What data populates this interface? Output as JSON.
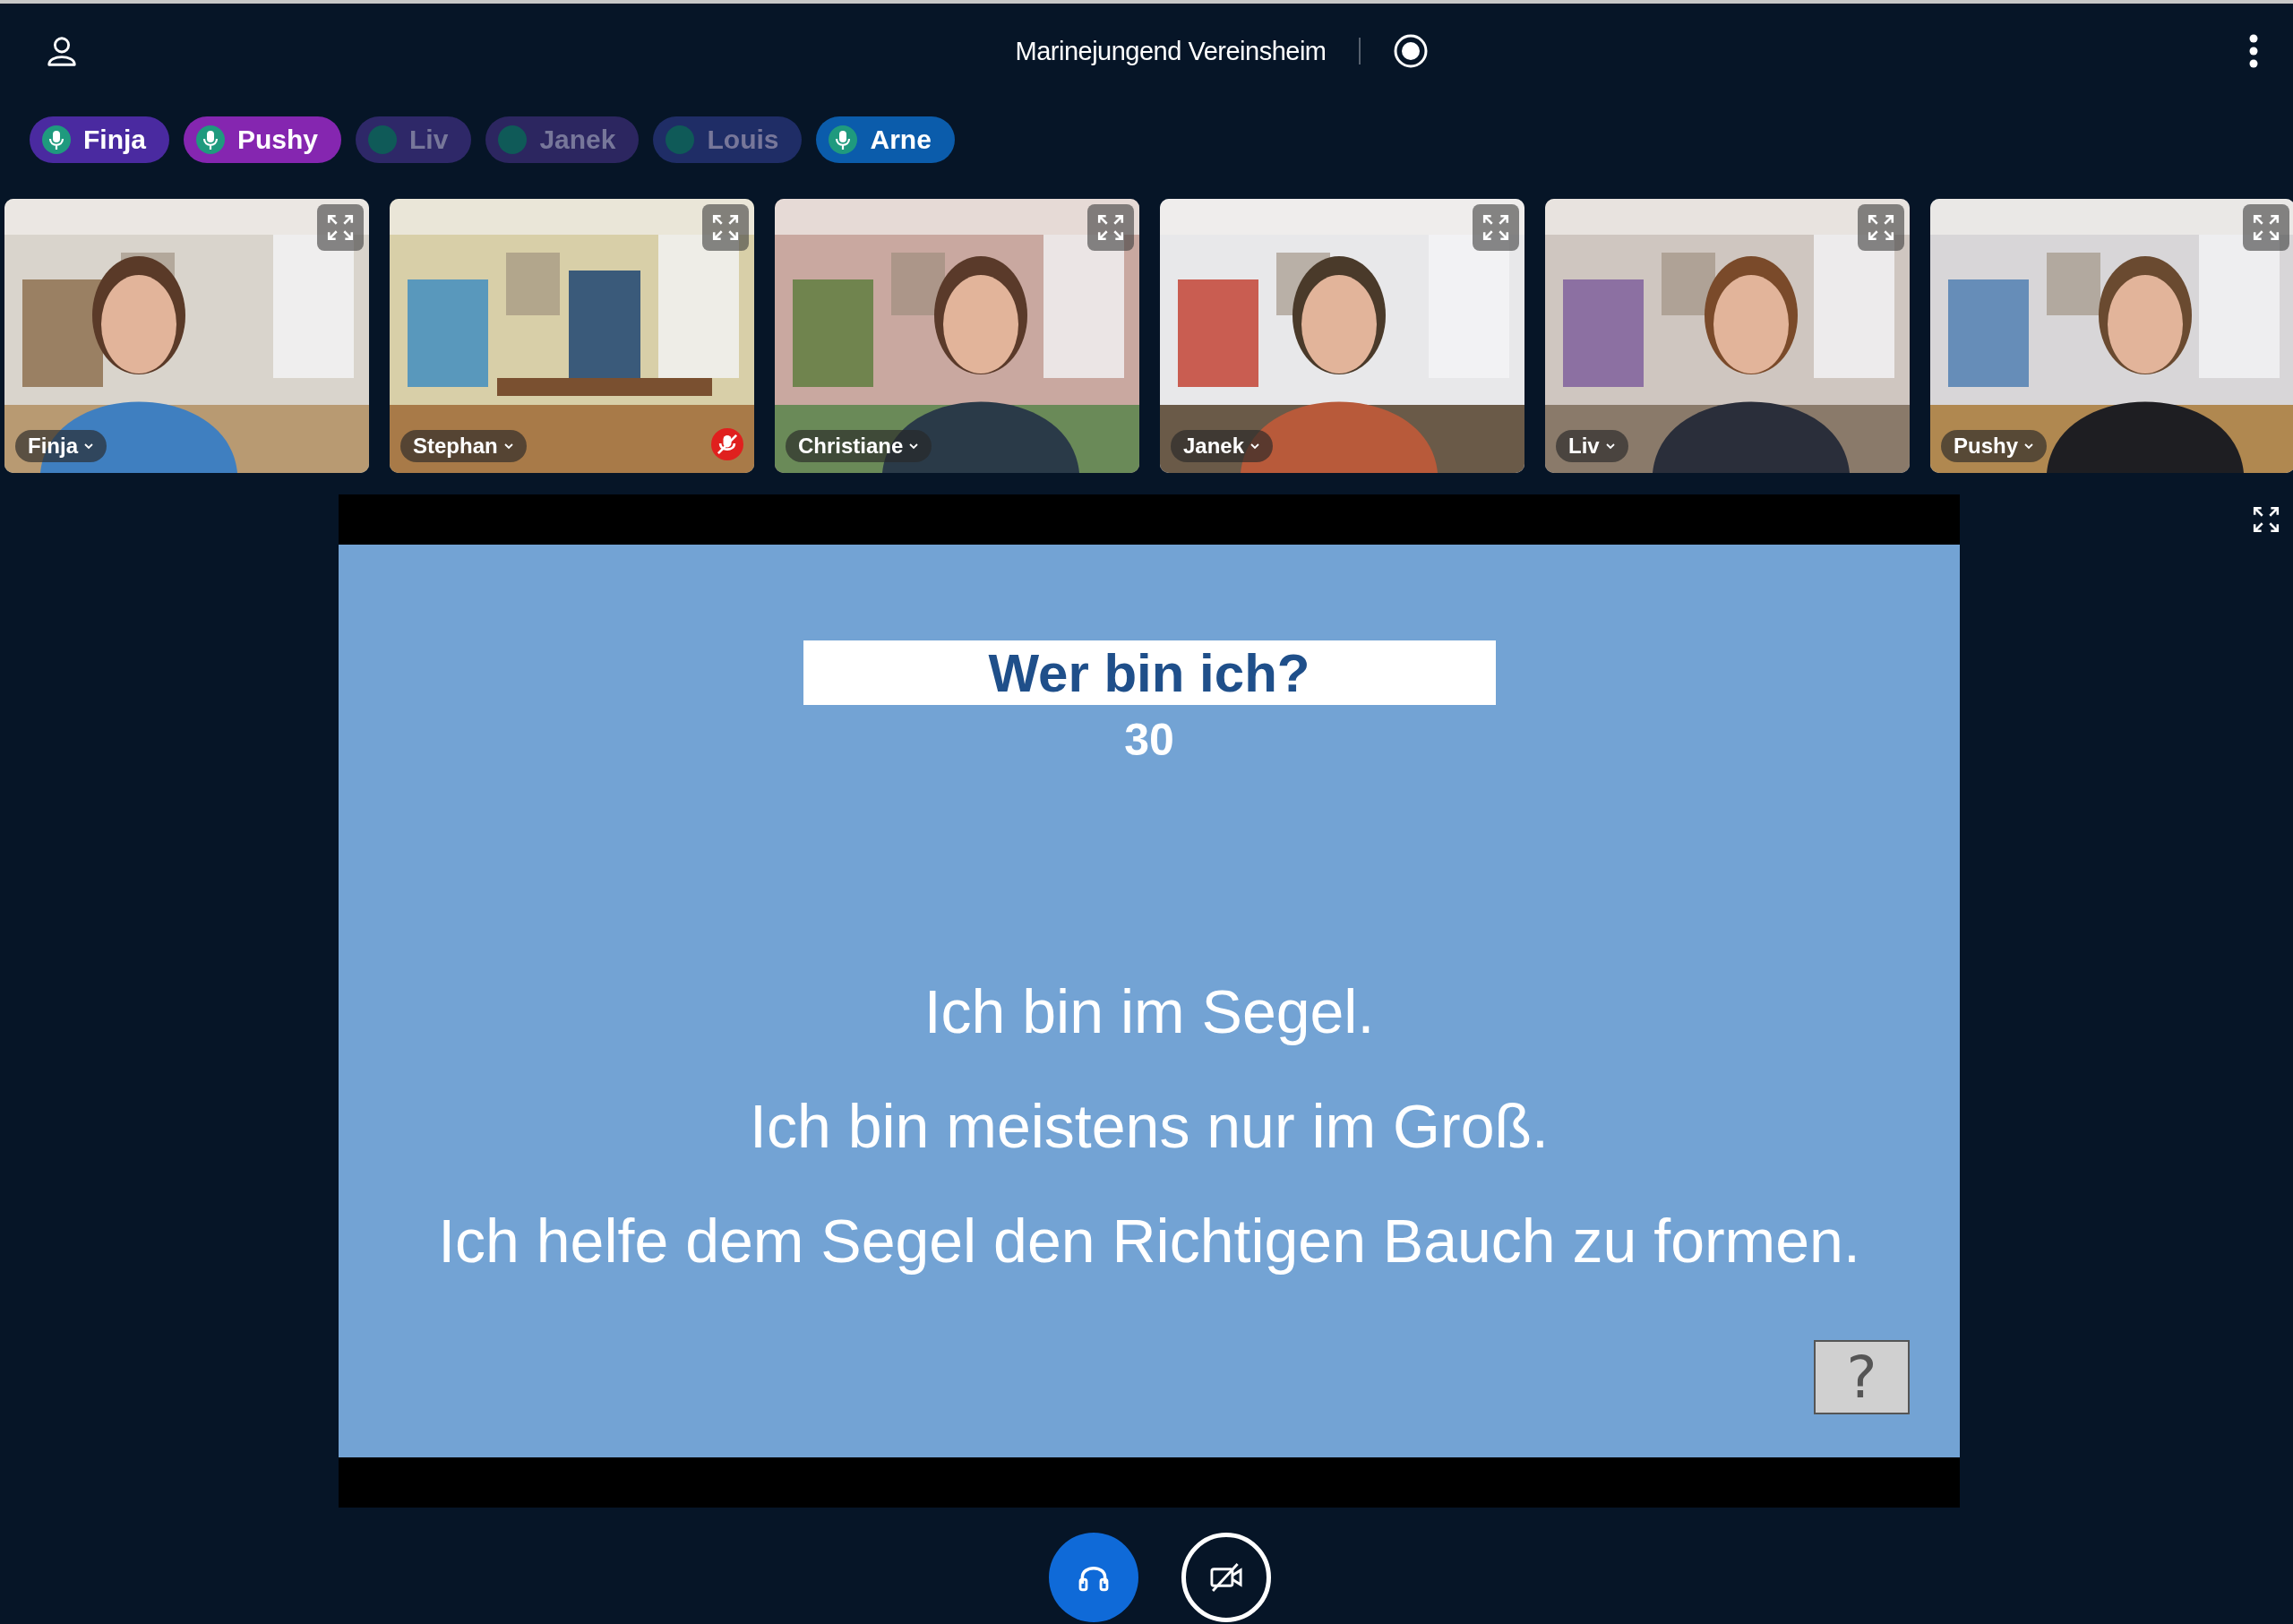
{
  "header": {
    "title": "Marinejungend Vereinsheim"
  },
  "talkers": [
    {
      "name": "Finja",
      "talking": true,
      "color": "#4a2aa0"
    },
    {
      "name": "Pushy",
      "talking": true,
      "color": "#8526b0"
    },
    {
      "name": "Liv",
      "talking": false,
      "color": "#2e2868"
    },
    {
      "name": "Janek",
      "talking": false,
      "color": "#2c2660"
    },
    {
      "name": "Louis",
      "talking": false,
      "color": "#1f2d66"
    },
    {
      "name": "Arne",
      "talking": true,
      "color": "#0b5cab"
    }
  ],
  "videos": [
    {
      "name": "Finja",
      "muted": false,
      "kind": "picture"
    },
    {
      "name": "Stephan",
      "muted": true,
      "kind": "picture"
    },
    {
      "name": "Christiane",
      "muted": false,
      "kind": "picture"
    },
    {
      "name": "Janek",
      "muted": false,
      "kind": "picture"
    },
    {
      "name": "Liv",
      "muted": false,
      "kind": "picture"
    },
    {
      "name": "Pushy",
      "muted": false,
      "kind": "picture"
    }
  ],
  "slide": {
    "title": "Wer bin ich?",
    "counter": "30",
    "lines": [
      "Ich bin im Segel.",
      "Ich bin meistens nur im Groß.",
      "Ich helfe dem Segel den Richtigen Bauch zu formen."
    ],
    "help_button": "?"
  }
}
